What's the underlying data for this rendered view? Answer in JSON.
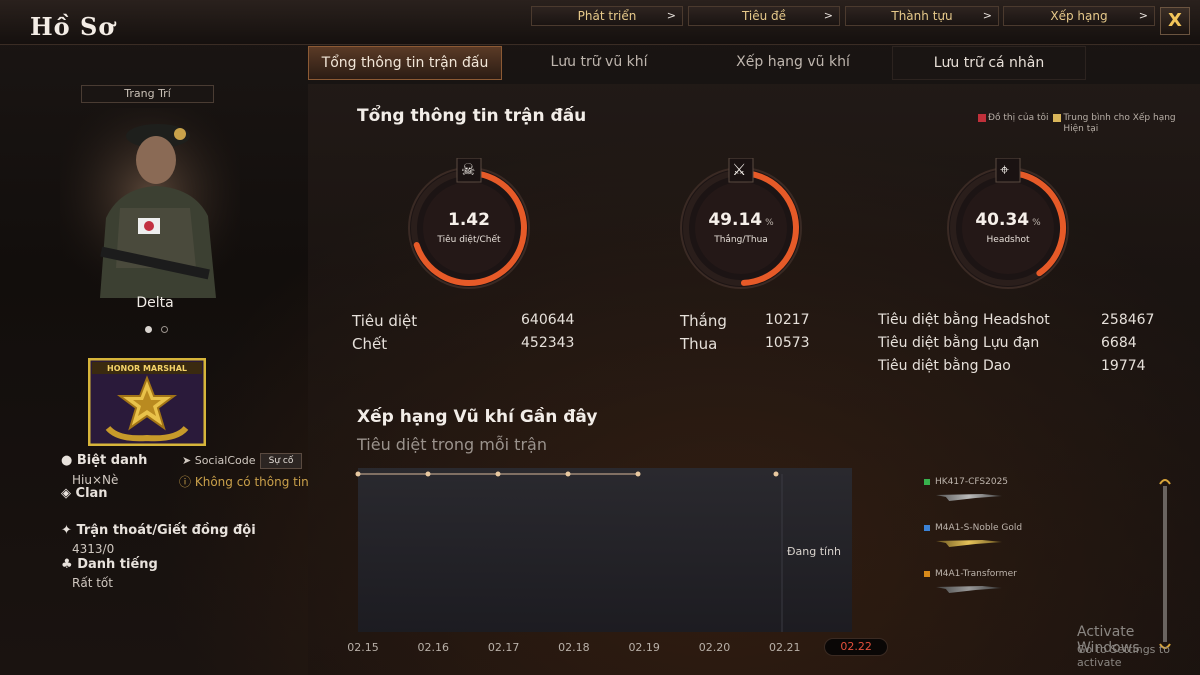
{
  "window": {
    "title": "Hồ Sơ",
    "close_label": "X"
  },
  "top_nav": [
    {
      "label": "Phát triển"
    },
    {
      "label": "Tiêu đề"
    },
    {
      "label": "Thành tựu"
    },
    {
      "label": "Xếp hạng"
    }
  ],
  "tabs": [
    {
      "label": "Tổng thông tin trận đấu",
      "state": "active"
    },
    {
      "label": "Lưu trữ vũ khí",
      "state": "normal"
    },
    {
      "label": "Xếp hạng vũ khí",
      "state": "normal"
    },
    {
      "label": "Lưu trữ cá nhân",
      "state": "dark"
    }
  ],
  "profile": {
    "decoration_button": "Trang Trí",
    "character_name": "Delta",
    "rank_badge_text": "HONOR MARSHAL",
    "nickname_label": "Biệt danh",
    "nickname_value": "Hiu×Nè",
    "social_code_label": "SocialCode",
    "social_code_button": "Sự cố",
    "social_code_value": "Không có thông tin",
    "clan_label": "Clan",
    "escape_label": "Trận thoát/Giết đồng đội",
    "escape_value": "4313/0",
    "reputation_label": "Danh tiếng",
    "reputation_value": "Rất tốt"
  },
  "summary": {
    "title": "Tổng thông tin trận đấu",
    "legend": [
      {
        "label": "Đồ thị của tôi",
        "color": "#c0303a"
      },
      {
        "label": "Trung bình cho Xếp hạng Hiện tại",
        "color": "#d8b55a"
      }
    ],
    "gauges": [
      {
        "icon": "skull-icon",
        "value": "1.42",
        "unit": "",
        "label": "Tiêu diệt/Chết",
        "fill": 0.7
      },
      {
        "icon": "crossed-swords-icon",
        "value": "49.14",
        "unit": "%",
        "label": "Thắng/Thua",
        "fill": 0.4914
      },
      {
        "icon": "crosshair-rifle-icon",
        "value": "40.34",
        "unit": "%",
        "label": "Headshot",
        "fill": 0.4034
      }
    ],
    "stats_col1": [
      {
        "label": "Tiêu diệt",
        "value": "640644"
      },
      {
        "label": "Chết",
        "value": "452343"
      }
    ],
    "stats_col2": [
      {
        "label": "Thắng",
        "value": "10217"
      },
      {
        "label": "Thua",
        "value": "10573"
      }
    ],
    "stats_col3": [
      {
        "label": "Tiêu diệt bằng Headshot",
        "value": "258467"
      },
      {
        "label": "Tiêu diệt bằng Lựu đạn",
        "value": "6684"
      },
      {
        "label": "Tiêu diệt bằng Dao",
        "value": "19774"
      }
    ]
  },
  "weapon_chart": {
    "title": "Xếp hạng Vũ khí Gần đây",
    "subtitle": "Tiêu diệt trong mỗi trận",
    "calculating_text": "Đang tính",
    "dates": [
      "02.15",
      "02.16",
      "02.17",
      "02.18",
      "02.19",
      "02.20",
      "02.21",
      "02.22"
    ],
    "selected_date": "02.22",
    "weapons": [
      {
        "name": "HK417-CFS2025",
        "color": "#37b24d"
      },
      {
        "name": "M4A1-S-Noble Gold",
        "color": "#3b82d6"
      },
      {
        "name": "M4A1-Transformer",
        "color": "#d88a1a"
      }
    ]
  },
  "watermark": {
    "line1": "Activate Windows",
    "line2": "Go to Settings to activate"
  }
}
